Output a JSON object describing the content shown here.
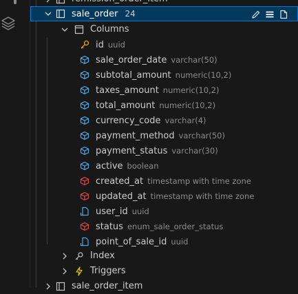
{
  "tree": {
    "partial_top": {
      "label": "remission_order_item"
    },
    "table": {
      "label": "sale_order",
      "count": "24"
    },
    "columns_group": {
      "label": "Columns"
    },
    "columns": [
      {
        "name": "id",
        "type": "uuid",
        "icon": "key-icon"
      },
      {
        "name": "sale_order_date",
        "type": "varchar(50)",
        "icon": "cube-icon"
      },
      {
        "name": "subtotal_amount",
        "type": "numeric(10,2)",
        "icon": "cube-icon"
      },
      {
        "name": "taxes_amount",
        "type": "numeric(10,2)",
        "icon": "cube-icon"
      },
      {
        "name": "total_amount",
        "type": "numeric(10,2)",
        "icon": "cube-icon"
      },
      {
        "name": "currency_code",
        "type": "varchar(4)",
        "icon": "cube-icon"
      },
      {
        "name": "payment_method",
        "type": "varchar(50)",
        "icon": "cube-icon"
      },
      {
        "name": "payment_status",
        "type": "varchar(30)",
        "icon": "cube-icon"
      },
      {
        "name": "active",
        "type": "boolean",
        "icon": "cube-icon"
      },
      {
        "name": "created_at",
        "type": "timestamp with time zone",
        "icon": "cube-red-icon"
      },
      {
        "name": "updated_at",
        "type": "timestamp with time zone",
        "icon": "cube-red-icon"
      },
      {
        "name": "user_id",
        "type": "uuid",
        "icon": "file-link-icon"
      },
      {
        "name": "status",
        "type": "enum_sale_order_status",
        "icon": "cube-red-icon"
      },
      {
        "name": "point_of_sale_id",
        "type": "uuid",
        "icon": "file-link-icon"
      }
    ],
    "index_group": {
      "label": "Index"
    },
    "triggers_group": {
      "label": "Triggers"
    },
    "partial_bottom": {
      "label": "sale_order_item"
    }
  },
  "colors": {
    "selection_bg": "#04395e",
    "selection_border": "#0078d4",
    "key": "#d7a22a",
    "cube_blue": "#4ea6e6",
    "cube_red": "#e04444",
    "file_link": "#4ea6e6",
    "trigger": "#e8c300"
  }
}
